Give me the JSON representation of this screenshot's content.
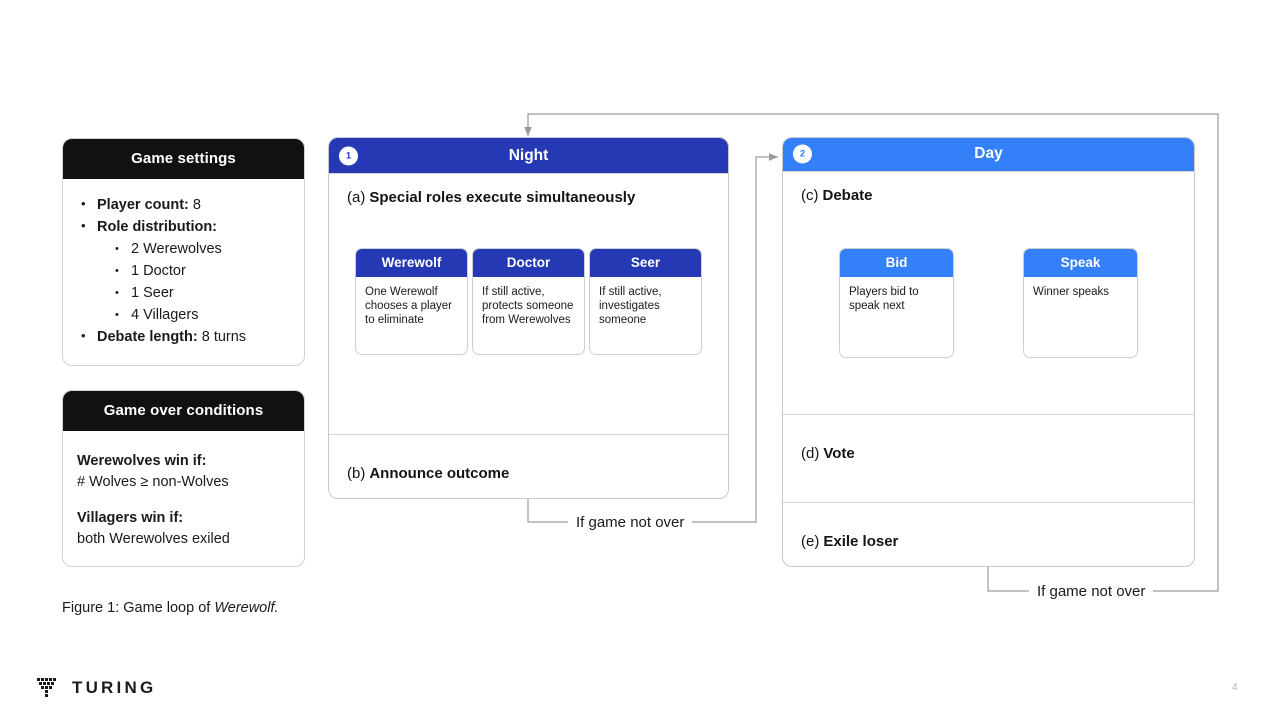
{
  "slide": {
    "caption_prefix": "Figure 1: Game loop of ",
    "caption_italic": "Werewolf.",
    "page_number": "4",
    "logo_text": "TURING"
  },
  "colors": {
    "night": "#2639b5",
    "day": "#3380f8",
    "panel_header": "#111111",
    "connector": "#9a9a9a"
  },
  "settings_panel": {
    "title": "Game settings",
    "items": [
      {
        "label": "Player count:",
        "value": " 8",
        "children": []
      },
      {
        "label": "Role distribution:",
        "value": "",
        "children": [
          "2 Werewolves",
          "1 Doctor",
          "1 Seer",
          "4 Villagers"
        ]
      },
      {
        "label": "Debate length:",
        "value": " 8 turns",
        "children": []
      }
    ]
  },
  "gameover_panel": {
    "title": "Game over conditions",
    "rules": [
      {
        "title": "Werewolves win if:",
        "detail": "# Wolves ≥ non-Wolves"
      },
      {
        "title": "Villagers win if:",
        "detail": "both Werewolves exiled"
      }
    ]
  },
  "night_stage": {
    "badge": "1",
    "title": "Night",
    "sections": [
      {
        "tag": "(a)",
        "text": "Special roles execute simultaneously"
      },
      {
        "tag": "(b)",
        "text": "Announce outcome"
      }
    ],
    "roles": [
      {
        "name": "Werewolf",
        "desc": "One Werewolf chooses a player to eliminate"
      },
      {
        "name": "Doctor",
        "desc": "If still active, protects someone from Werewolves"
      },
      {
        "name": "Seer",
        "desc": "If still active, investigates someone"
      }
    ]
  },
  "day_stage": {
    "badge": "2",
    "title": "Day",
    "sections": [
      {
        "tag": "(c)",
        "text": "Debate"
      },
      {
        "tag": "(d)",
        "text": "Vote"
      },
      {
        "tag": "(e)",
        "text": "Exile loser"
      }
    ],
    "actions": [
      {
        "name": "Bid",
        "desc": "Players bid to speak next"
      },
      {
        "name": "Speak",
        "desc": "Winner speaks"
      }
    ]
  },
  "edges": {
    "night_to_day_label": "If game not over",
    "day_to_night_label": "If game not over"
  }
}
